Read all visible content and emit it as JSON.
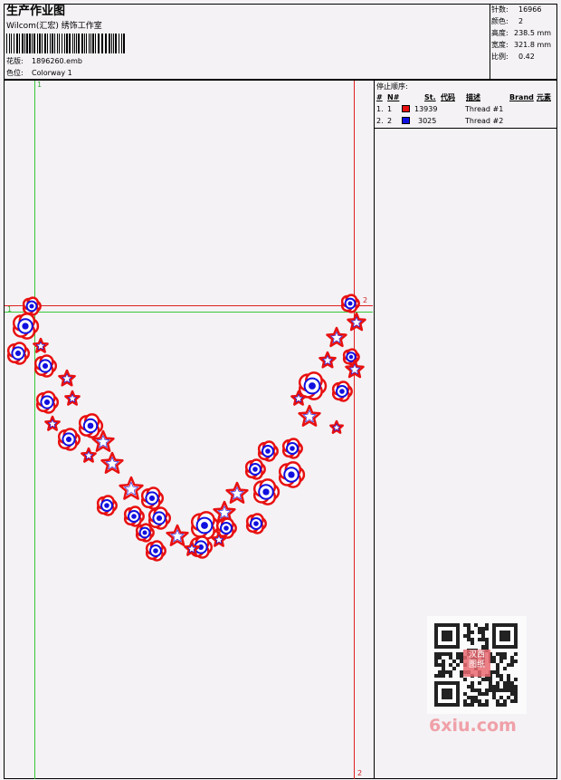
{
  "header": {
    "title": "生产作业图",
    "company": "Wilcom(汇宏) 绣饰工作室",
    "design_label": "花版:",
    "design_value": "1896260.emb",
    "colorway_label": "色位:",
    "colorway_value": "Colorway 1"
  },
  "stats": {
    "stitches_label": "针数:",
    "stitches_value": "16966",
    "colors_label": "颜色:",
    "colors_value": "2",
    "height_label": "高度:",
    "height_value": "238.5 mm",
    "width_label": "宽度:",
    "width_value": "321.8 mm",
    "scale_label": "比例:",
    "scale_value": "0.42"
  },
  "stop_sequence": {
    "title": "停止顺序:",
    "columns": [
      "#",
      "N#",
      "St.",
      "代码",
      "描述",
      "Brand",
      "元素"
    ],
    "rows": [
      {
        "index": "1.",
        "needle": "1",
        "color": "#e81010",
        "code": "13939",
        "description": "Thread #1"
      },
      {
        "index": "2.",
        "needle": "2",
        "color": "#1010e0",
        "code": "3025",
        "description": "Thread #2"
      }
    ]
  },
  "guides": {
    "marker_1": "1",
    "marker_2": "2"
  },
  "watermark": {
    "qr_stamp": "汉西图纸",
    "site": "6xiu.com"
  },
  "colors": {
    "thread1": "#e81010",
    "thread2": "#1010e0",
    "guide_green": "#38c838",
    "guide_red": "#e02020"
  }
}
